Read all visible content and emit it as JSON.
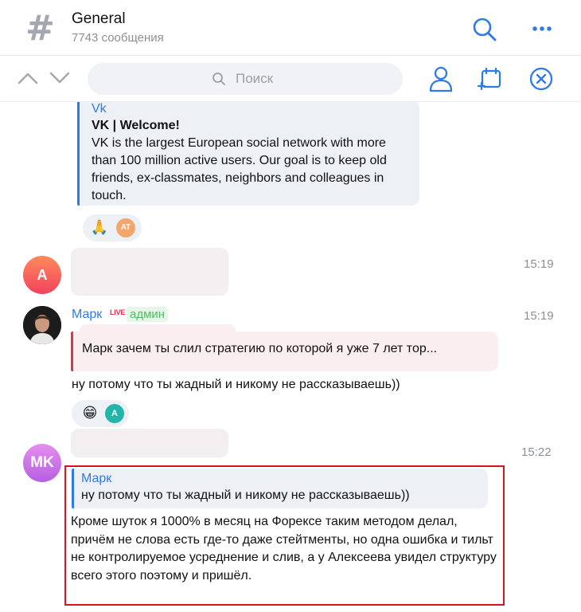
{
  "header": {
    "title": "General",
    "subtitle": "7743 сообщения"
  },
  "search": {
    "placeholder": "Поиск"
  },
  "link_preview": {
    "site": "Vk",
    "title": "VK | Welcome!",
    "description": "VK is the largest European social network with more than 100 million active users. Our goal is to keep old friends, ex-classmates, neighbors and colleagues in touch."
  },
  "reactions_1": {
    "emoji": "🙏",
    "avatar_initials": "AT"
  },
  "message_a": {
    "avatar_initial": "A",
    "time": "15:19"
  },
  "message_mark": {
    "sender": "Марк",
    "live_badge": "LIVE",
    "role_badge": "админ",
    "time": "15:19",
    "reply_text": "Марк зачем ты слил стратегию по которой я уже 7 лет тор...",
    "text": "ну потому что ты жадный и никому не рассказываешь))"
  },
  "reactions_2": {
    "emoji": "😁",
    "avatar_initials": "A"
  },
  "message_mk": {
    "avatar_initials": "MK",
    "time": "15:22",
    "reply_name": "Марк",
    "reply_text": "ну потому что ты жадный и никому не рассказываешь))",
    "text": "Кроме шуток я 1000% в месяц на Форексе таким методом делал, причём не слова есть где-то даже стейтменты, но одна ошибка и тильт не контролируемое усреднение и слив, а у Алексеева увидел структуру всего этого поэтому и пришёл."
  },
  "colors": {
    "accent": "#2e7be5",
    "highlight_border": "#d7141c",
    "admin_green": "#4dbd62",
    "live_red": "#e8324d"
  },
  "icons": [
    "hash-icon",
    "search-icon",
    "more-icon",
    "chevron-up-icon",
    "chevron-down-icon",
    "user-icon",
    "calendar-icon",
    "close-icon"
  ]
}
